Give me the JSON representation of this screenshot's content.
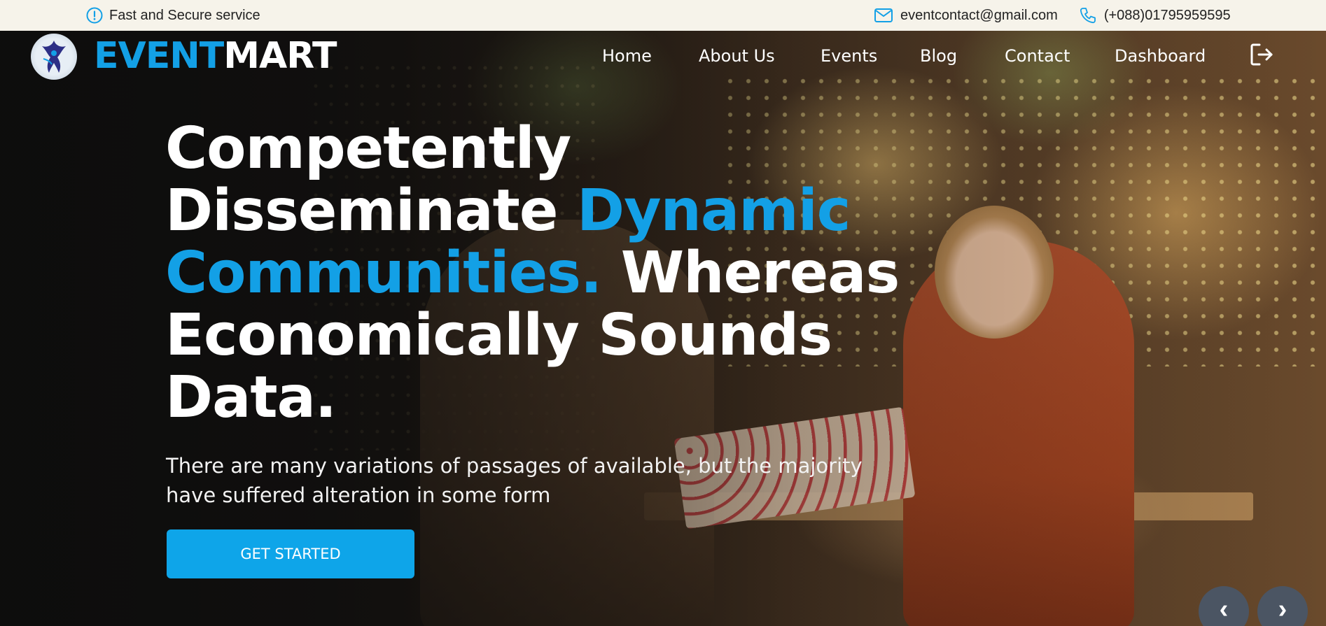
{
  "topbar": {
    "notice_text": "Fast and Secure service",
    "notice_icon": "info-circle-icon",
    "email": "eventcontact@gmail.com",
    "email_icon": "mail-icon",
    "phone": "(+088)01795959595",
    "phone_icon": "phone-icon"
  },
  "brand": {
    "part1": "EVENT",
    "part2": "MART",
    "logo_icon": "logo-emblem-icon"
  },
  "nav": {
    "items": [
      {
        "label": "Home"
      },
      {
        "label": "About Us"
      },
      {
        "label": "Events"
      },
      {
        "label": "Blog"
      },
      {
        "label": "Contact"
      },
      {
        "label": "Dashboard"
      }
    ],
    "logout_icon": "logout-icon"
  },
  "hero": {
    "headline_part1": "Competently Disseminate ",
    "headline_accent": "Dynamic Communities.",
    "headline_part2": " Whereas Economically Sounds Data.",
    "subtext": "There are many variations of passages of available, but the majority have suffered alteration in some form",
    "cta_label": "GET STARTED",
    "prev_label": "‹",
    "next_label": "›"
  },
  "colors": {
    "accent": "#13a0e6",
    "topbar_bg": "#f6f3ea",
    "cta_bg": "#0ea5e9"
  }
}
